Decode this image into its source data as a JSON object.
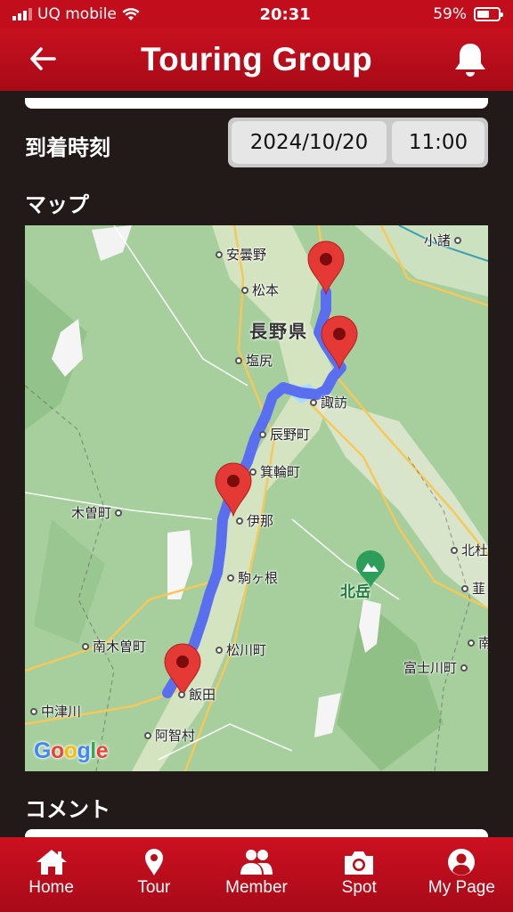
{
  "status_bar": {
    "carrier": "UQ mobile",
    "time": "20:31",
    "battery": "59%",
    "battery_level": 0.59
  },
  "header": {
    "title": "Touring Group",
    "back_icon": "arrow-left-icon",
    "bell_icon": "bell-icon"
  },
  "form": {
    "arrival_label": "到着時刻",
    "arrival_date": "2024/10/20",
    "arrival_time": "11:00",
    "map_label": "マップ",
    "comment_label": "コメント"
  },
  "map": {
    "prefecture": "長野県",
    "cities": {
      "azumino": "安曇野",
      "komoro": "小諸",
      "matsumoto": "松本",
      "shiojiri": "塩尻",
      "suwa": "諏訪",
      "tatsuno": "辰野町",
      "minowa": "箕輪町",
      "kiso": "木曽町",
      "ina": "伊那",
      "komagane": "駒ヶ根",
      "kitato": "北杜",
      "nirasaki": "韮",
      "minamikiso": "南木曽町",
      "matsukawa": "松川町",
      "fujikawa": "富士川町",
      "iida": "飯田",
      "nakatsugawa": "中津川",
      "achi": "阿智村",
      "nan": "南"
    },
    "mountain": "北岳",
    "attribution": "Google",
    "route_color": "#5a6ff0",
    "marker_color": "#e53935"
  },
  "nav": {
    "items": [
      {
        "label": "Home",
        "icon": "home-icon"
      },
      {
        "label": "Tour",
        "icon": "location-pin-icon"
      },
      {
        "label": "Member",
        "icon": "group-icon"
      },
      {
        "label": "Spot",
        "icon": "camera-icon"
      },
      {
        "label": "My Page",
        "icon": "user-circle-icon"
      }
    ]
  }
}
